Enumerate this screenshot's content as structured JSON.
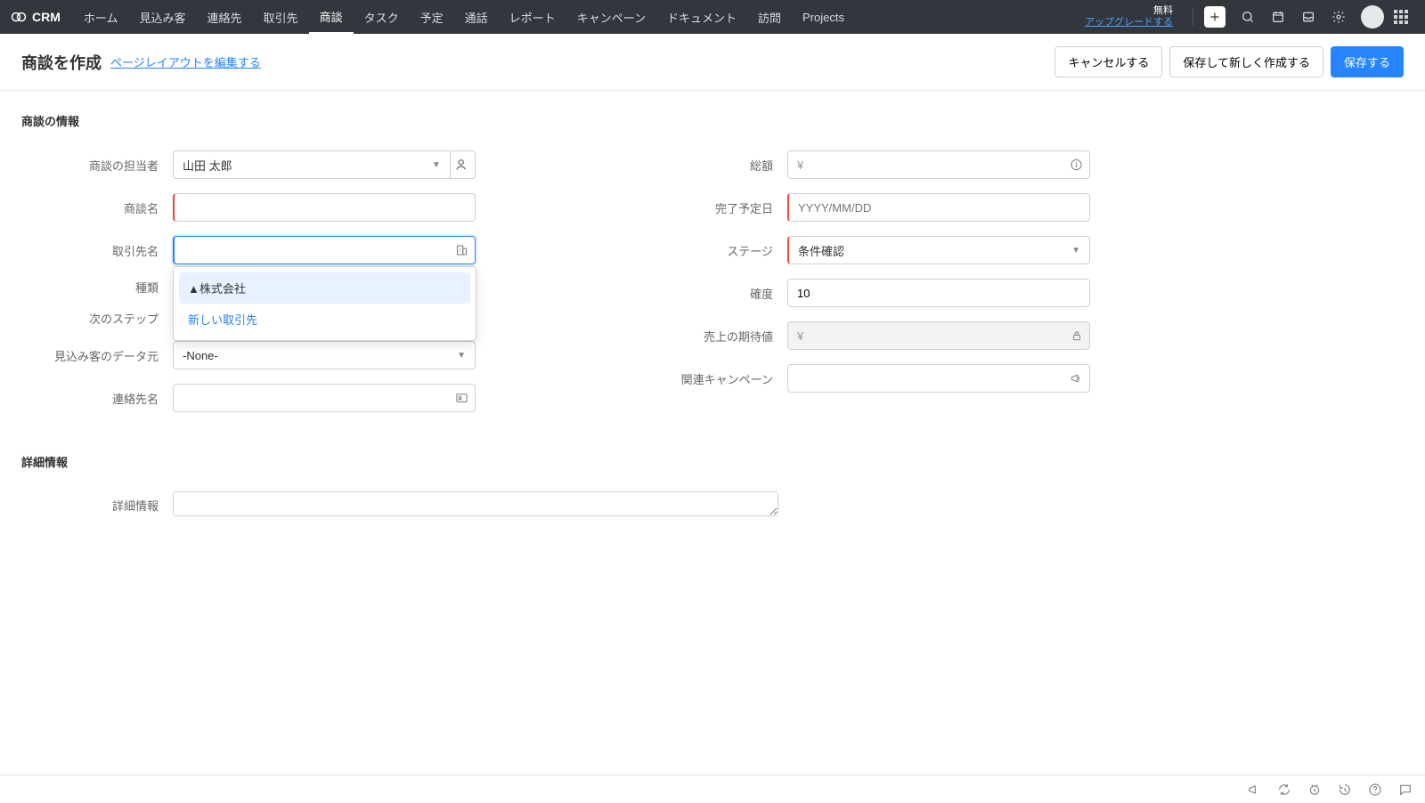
{
  "brand": {
    "name": "CRM"
  },
  "nav": {
    "items": [
      "ホーム",
      "見込み客",
      "連絡先",
      "取引先",
      "商談",
      "タスク",
      "予定",
      "通話",
      "レポート",
      "キャンペーン",
      "ドキュメント",
      "訪問",
      "Projects"
    ],
    "active_index": 4
  },
  "upgrade": {
    "line1": "無料",
    "line2": "アップグレードする"
  },
  "page": {
    "title": "商談を作成",
    "edit_layout": "ページレイアウトを編集する"
  },
  "actions": {
    "cancel": "キャンセルする",
    "save_new": "保存して新しく作成する",
    "save": "保存する"
  },
  "sections": {
    "info": "商談の情報",
    "detail": "詳細情報"
  },
  "fields": {
    "owner": {
      "label": "商談の担当者",
      "value": "山田 太郎"
    },
    "deal_name": {
      "label": "商談名",
      "value": ""
    },
    "account": {
      "label": "取引先名",
      "value": ""
    },
    "type": {
      "label": "種類",
      "value": ""
    },
    "next_step": {
      "label": "次のステップ",
      "value": ""
    },
    "lead_source": {
      "label": "見込み客のデータ元",
      "value": "-None-"
    },
    "contact": {
      "label": "連絡先名",
      "value": ""
    },
    "amount": {
      "label": "総額",
      "prefix": "¥",
      "value": ""
    },
    "close_date": {
      "label": "完了予定日",
      "placeholder": "YYYY/MM/DD",
      "value": ""
    },
    "stage": {
      "label": "ステージ",
      "value": "条件確認"
    },
    "probability": {
      "label": "確度",
      "value": "10"
    },
    "expected_revenue": {
      "label": "売上の期待値",
      "prefix": "¥",
      "value": ""
    },
    "campaign": {
      "label": "関連キャンペーン",
      "value": ""
    },
    "description": {
      "label": "詳細情報",
      "value": ""
    }
  },
  "dropdown": {
    "account_options": [
      "▲株式会社"
    ],
    "new_link": "新しい取引先"
  }
}
